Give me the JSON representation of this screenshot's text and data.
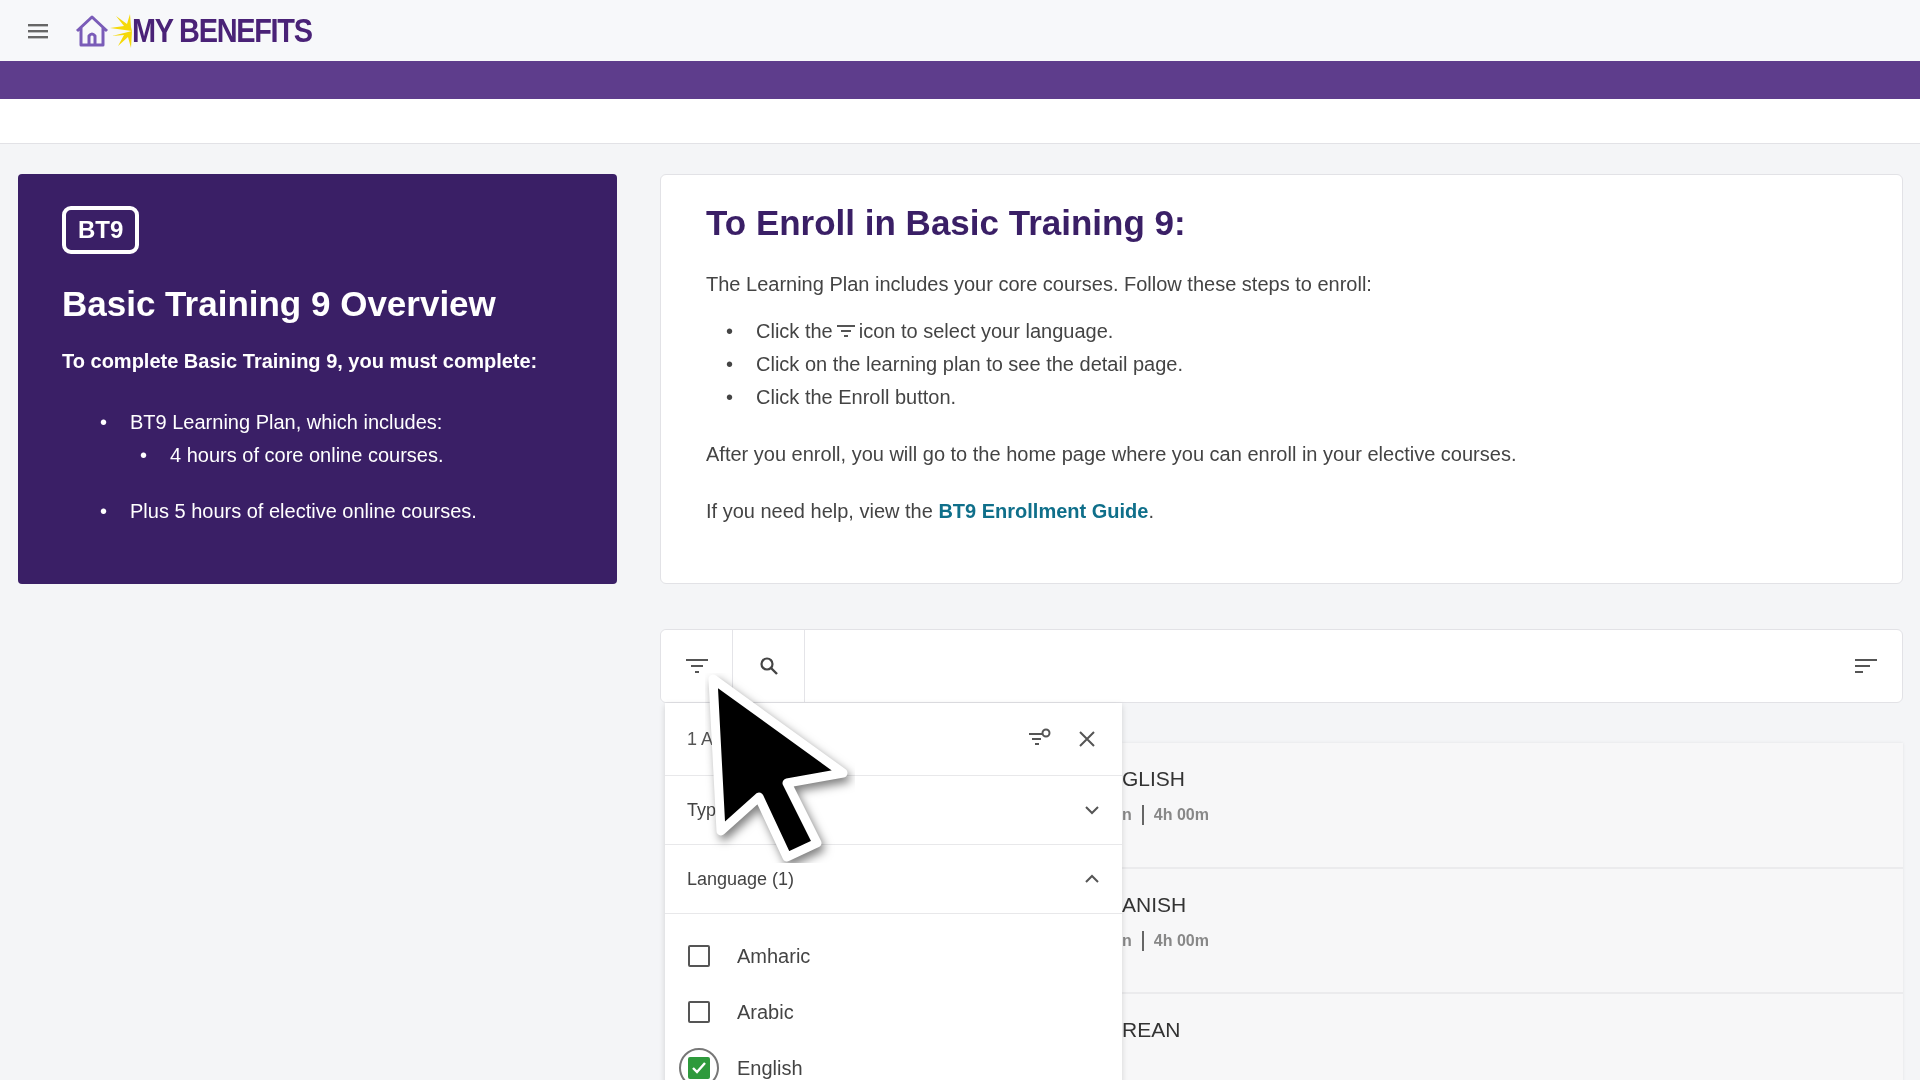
{
  "header": {
    "logo_text": "MY BENEFITS"
  },
  "overview": {
    "badge": "BT9",
    "title": "Basic Training 9 Overview",
    "intro": "To complete Basic Training 9, you must complete:",
    "items": [
      {
        "marker": "•",
        "text": "BT9 Learning Plan, which includes:",
        "children": [
          {
            "marker": "•",
            "text": "4 hours of core online courses."
          }
        ]
      },
      {
        "marker": "•",
        "text": "Plus 5 hours of elective online courses."
      }
    ]
  },
  "enroll": {
    "title": "To Enroll in Basic Training 9:",
    "intro": "The Learning Plan includes your core courses. Follow these steps to enroll:",
    "steps": [
      {
        "kind": "icon",
        "marker": "•",
        "before": "Click the",
        "after": "icon to select your language."
      },
      {
        "kind": "text",
        "marker": "•",
        "text": "Click on the learning plan to see the detail page."
      },
      {
        "kind": "text",
        "marker": "•",
        "text": "Click the Enroll button."
      }
    ],
    "after": "After you enroll, you will go to the home page where you can enroll in your elective courses.",
    "help_before": "If you need help, view the",
    "help_link": "BT9 Enrollment Guide",
    "help_after": "."
  },
  "filter_panel": {
    "count": "1 A",
    "sections": [
      {
        "label": "Typ",
        "expanded": false
      },
      {
        "label": "Language (1)",
        "expanded": true,
        "options": [
          {
            "label": "Amharic",
            "checked": false,
            "focused": false
          },
          {
            "label": "Arabic",
            "checked": false,
            "focused": false
          },
          {
            "label": "English",
            "checked": true,
            "focused": true
          }
        ]
      }
    ]
  },
  "results": [
    {
      "title": "GLISH",
      "meta": [
        "n",
        "4h 00m"
      ]
    },
    {
      "title": "ANISH",
      "meta": [
        "n",
        "4h 00m"
      ]
    },
    {
      "title": "REAN"
    }
  ]
}
